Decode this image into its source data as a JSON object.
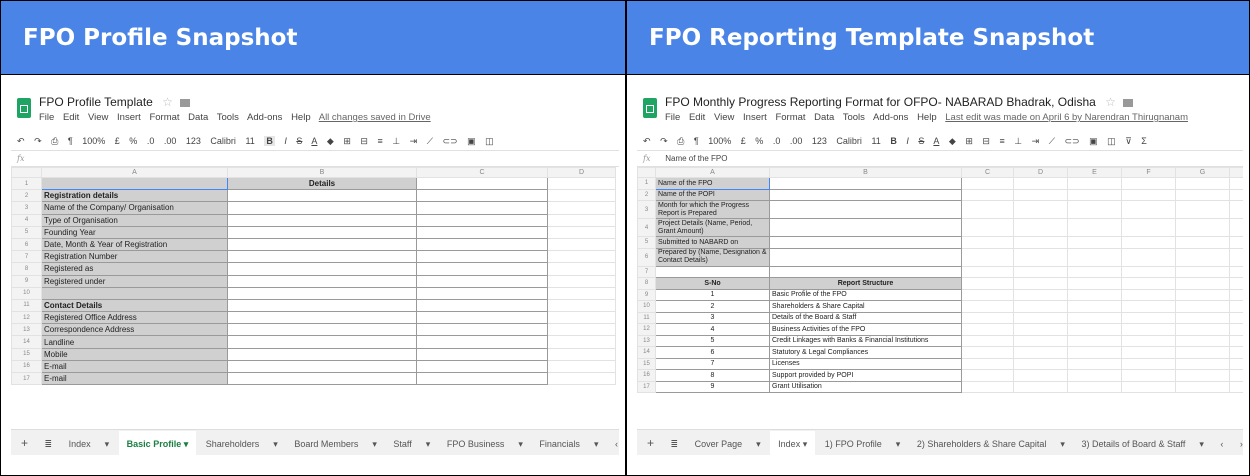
{
  "left": {
    "banner": "FPO Profile Snapshot",
    "doc_title": "FPO Profile Template",
    "menu": [
      "File",
      "Edit",
      "View",
      "Insert",
      "Format",
      "Data",
      "Tools",
      "Add-ons",
      "Help"
    ],
    "saved_status": "All changes saved in Drive",
    "toolbar": {
      "zoom": "100%",
      "currency": "£",
      "percent": "%",
      "dec_less": ".0",
      "dec_more": ".00",
      "format": "123",
      "font": "Calibri",
      "size": "11"
    },
    "fx_value": "",
    "col_headers": [
      "A",
      "B",
      "C",
      "D"
    ],
    "rows": [
      {
        "n": "1",
        "a": "",
        "b": "Details"
      },
      {
        "n": "2",
        "a": "Registration details",
        "b": ""
      },
      {
        "n": "3",
        "a": "Name of the Company/ Organisation",
        "b": ""
      },
      {
        "n": "4",
        "a": "Type of Organisation",
        "b": ""
      },
      {
        "n": "5",
        "a": "Founding Year",
        "b": ""
      },
      {
        "n": "6",
        "a": "Date, Month & Year of Registration",
        "b": ""
      },
      {
        "n": "7",
        "a": "Registration Number",
        "b": ""
      },
      {
        "n": "8",
        "a": "Registered as",
        "b": ""
      },
      {
        "n": "9",
        "a": "Registered under",
        "b": ""
      },
      {
        "n": "10",
        "a": "",
        "b": ""
      },
      {
        "n": "11",
        "a": "Contact Details",
        "b": ""
      },
      {
        "n": "12",
        "a": "Registered Office Address",
        "b": ""
      },
      {
        "n": "13",
        "a": "Correspondence Address",
        "b": ""
      },
      {
        "n": "14",
        "a": "Landline",
        "b": ""
      },
      {
        "n": "15",
        "a": "Mobile",
        "b": ""
      },
      {
        "n": "16",
        "a": "E-mail",
        "b": ""
      },
      {
        "n": "17",
        "a": "E-mail",
        "b": ""
      }
    ],
    "tabs": [
      "Index",
      "Basic Profile",
      "Shareholders",
      "Board Members",
      "Staff",
      "FPO Business",
      "Financials"
    ],
    "active_tab": "Basic Profile"
  },
  "right": {
    "banner": "FPO Reporting Template Snapshot",
    "doc_title": "FPO Monthly Progress Reporting Format for OFPO- NABARAD Bhadrak, Odisha",
    "menu": [
      "File",
      "Edit",
      "View",
      "Insert",
      "Format",
      "Data",
      "Tools",
      "Add-ons",
      "Help"
    ],
    "saved_status": "Last edit was made on April 6 by Narendran Thirugnanam",
    "toolbar": {
      "zoom": "100%",
      "currency": "£",
      "percent": "%",
      "dec_less": ".0",
      "dec_more": ".00",
      "format": "123",
      "font": "Calibri",
      "size": "11"
    },
    "fx_value": "Name of the FPO",
    "col_headers": [
      "A",
      "B",
      "C",
      "D",
      "E",
      "F",
      "G"
    ],
    "info_rows": [
      {
        "n": "1",
        "a": "Name of the FPO",
        "tall": false
      },
      {
        "n": "2",
        "a": "Name of the POPI",
        "tall": false
      },
      {
        "n": "3",
        "a": "Month for which the Progress Report is Prepared",
        "tall": true
      },
      {
        "n": "4",
        "a": "Project Details (Name, Period, Grant Amount)",
        "tall": true
      },
      {
        "n": "5",
        "a": "Submitted to NABARD on",
        "tall": false
      },
      {
        "n": "6",
        "a": "Prepared by (Name, Designation & Contact Details)",
        "tall": true
      },
      {
        "n": "7",
        "a": "",
        "tall": false
      }
    ],
    "structure_header": {
      "n": "8",
      "sno": "S-No",
      "title": "Report Structure"
    },
    "structure_rows": [
      {
        "n": "9",
        "sno": "1",
        "title": "Basic Profile of the FPO"
      },
      {
        "n": "10",
        "sno": "2",
        "title": "Shareholders & Share Capital"
      },
      {
        "n": "11",
        "sno": "3",
        "title": "Details of the Board & Staff"
      },
      {
        "n": "12",
        "sno": "4",
        "title": "Business Activities of the FPO"
      },
      {
        "n": "13",
        "sno": "5",
        "title": "Credit Linkages with Banks & Financial Institutions"
      },
      {
        "n": "14",
        "sno": "6",
        "title": "Statutory & Legal Compliances"
      },
      {
        "n": "15",
        "sno": "7",
        "title": "Licenses"
      },
      {
        "n": "16",
        "sno": "8",
        "title": "Support provided by POPI"
      },
      {
        "n": "17",
        "sno": "9",
        "title": "Grant Utilisation"
      }
    ],
    "tabs": [
      "Cover Page",
      "Index",
      "1) FPO Profile",
      "2) Shareholders & Share Capital",
      "3) Details of Board & Staff"
    ],
    "active_tab": "Index"
  }
}
